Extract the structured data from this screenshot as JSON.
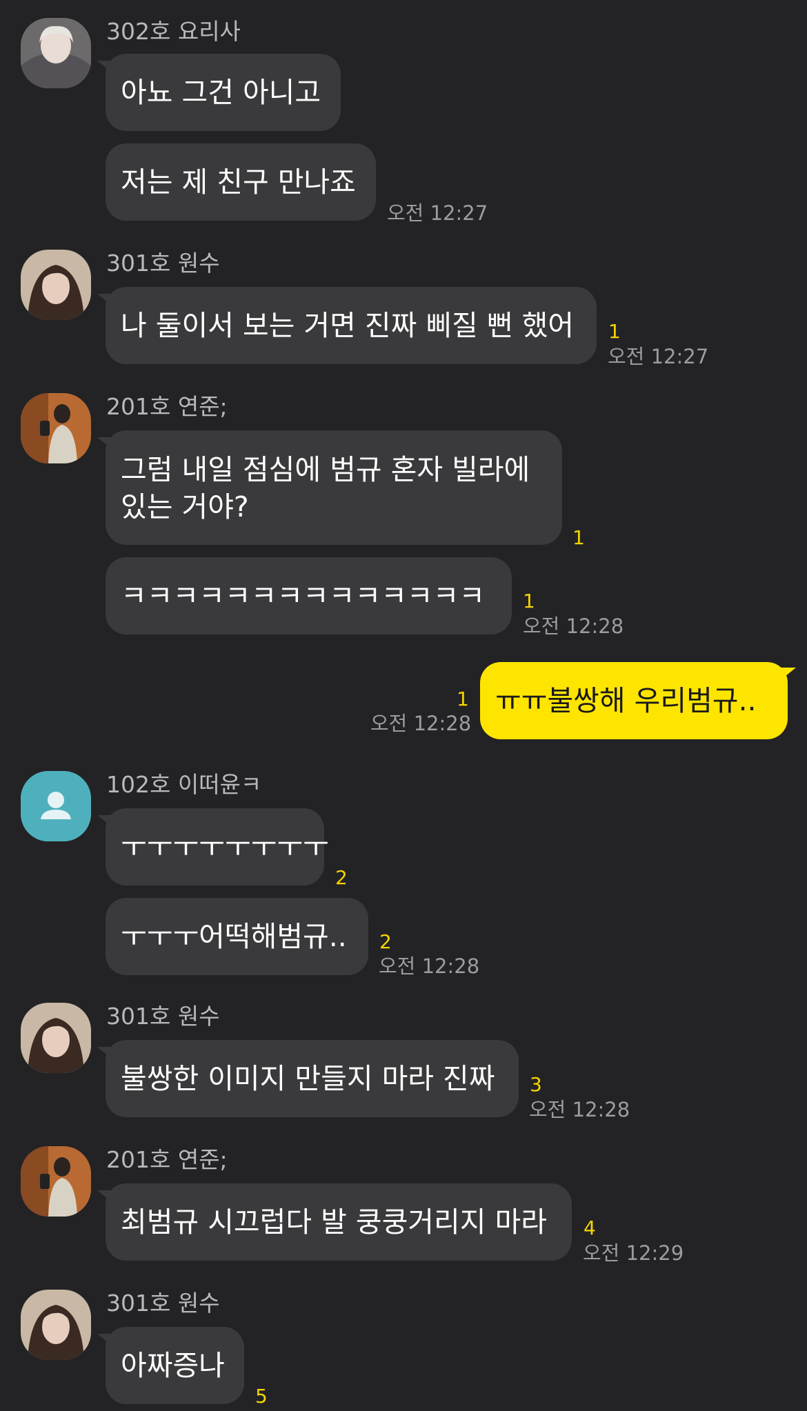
{
  "messages": [
    {
      "sender": "302호 요리사",
      "bubbles": [
        "아뇨 그건 아니고",
        "저는 제 친구 만나죠"
      ],
      "time": "오전 12:27"
    },
    {
      "sender": "301호 원수",
      "bubbles": [
        "나 둘이서 보는 거면 진짜 삐질 뻔 했어"
      ],
      "unread": [
        "1"
      ],
      "time": "오전 12:27"
    },
    {
      "sender": "201호 연준;",
      "bubbles": [
        "그럼 내일 점심에 범규 혼자 빌라에",
        "있는 거야?",
        "ㅋㅋㅋㅋㅋㅋㅋㅋㅋㅋㅋㅋㅋㅋ"
      ],
      "unread": [
        "1",
        "1"
      ],
      "time": "오전 12:28"
    },
    {
      "mine": true,
      "bubbles": [
        "ㅠㅠ불쌍해 우리범규.."
      ],
      "unread": [
        "1"
      ],
      "time": "오전 12:28"
    },
    {
      "sender": "102호 이떠윤ㅋ",
      "bubbles": [
        "ㅜㅜㅜㅜㅜㅜㅜㅜ",
        "ㅜㅜㅜ어떡해범규.."
      ],
      "unread": [
        "2",
        "2"
      ],
      "time": "오전 12:28"
    },
    {
      "sender": "301호 원수",
      "bubbles": [
        "불쌍한 이미지 만들지 마라 진짜"
      ],
      "unread": [
        "3"
      ],
      "time": "오전 12:28"
    },
    {
      "sender": "201호 연준;",
      "bubbles": [
        "최범규 시끄럽다 발 쿵쿵거리지 마라"
      ],
      "unread": [
        "4"
      ],
      "time": "오전 12:29"
    },
    {
      "sender": "301호 원수",
      "bubbles": [
        "아짜증나"
      ],
      "unread": [
        "5"
      ]
    }
  ],
  "colors": {
    "background": "#232325",
    "bubble_other": "#3a3a3c",
    "bubble_mine": "#fee500",
    "unread": "#f5d400",
    "time": "#9c9ca1"
  },
  "icons": {
    "default_avatar": "person-silhouette-icon"
  }
}
